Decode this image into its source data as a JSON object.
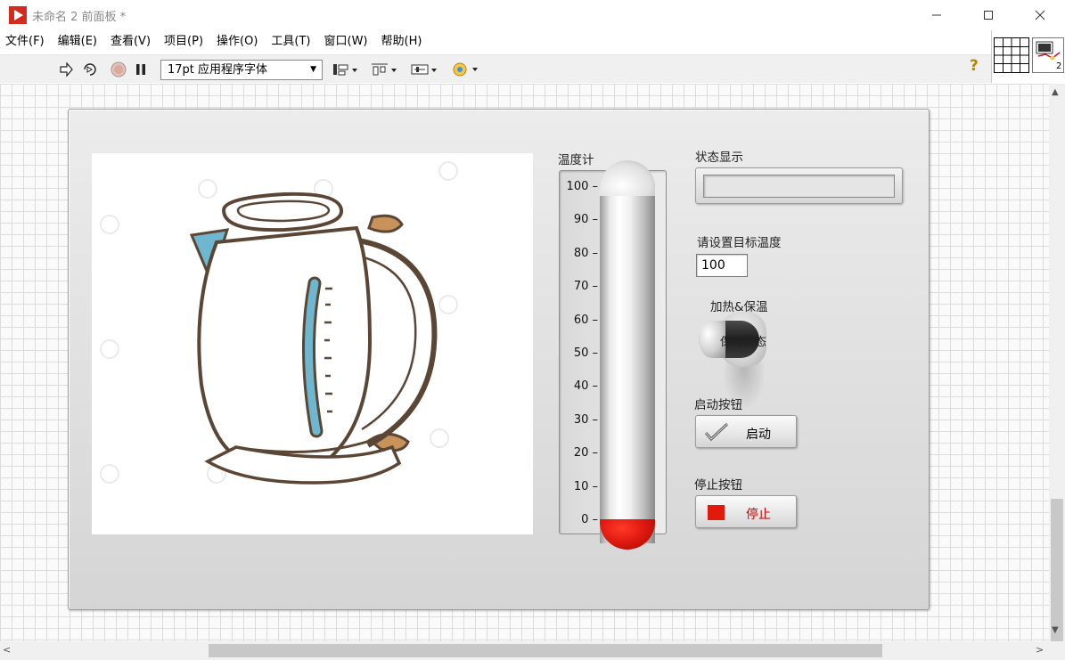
{
  "window": {
    "title": "未命名 2 前面板 *",
    "icon": "labview-play-icon",
    "controls": [
      "minimize-icon",
      "maximize-icon",
      "close-icon"
    ]
  },
  "menu": [
    "文件(F)",
    "编辑(E)",
    "查看(V)",
    "项目(P)",
    "操作(O)",
    "工具(T)",
    "窗口(W)",
    "帮助(H)"
  ],
  "toolbar": {
    "font": "17pt 应用程序字体",
    "help": "?",
    "vi_icon_number": "2"
  },
  "thermometer": {
    "label": "温度计",
    "ticks": [
      "100",
      "90",
      "80",
      "70",
      "60",
      "50",
      "40",
      "30",
      "20",
      "10",
      "0"
    ],
    "value": 0,
    "fill_color": "#e01a10"
  },
  "status": {
    "label": "状态显示",
    "value": ""
  },
  "target": {
    "label": "请设置目标温度",
    "value": "100"
  },
  "switch": {
    "label": "加热&保温",
    "state": "保持状态"
  },
  "start": {
    "label": "启动按钮",
    "button": "启动"
  },
  "stop": {
    "label": "停止按钮",
    "button": "停止",
    "color": "#e21a0c"
  }
}
